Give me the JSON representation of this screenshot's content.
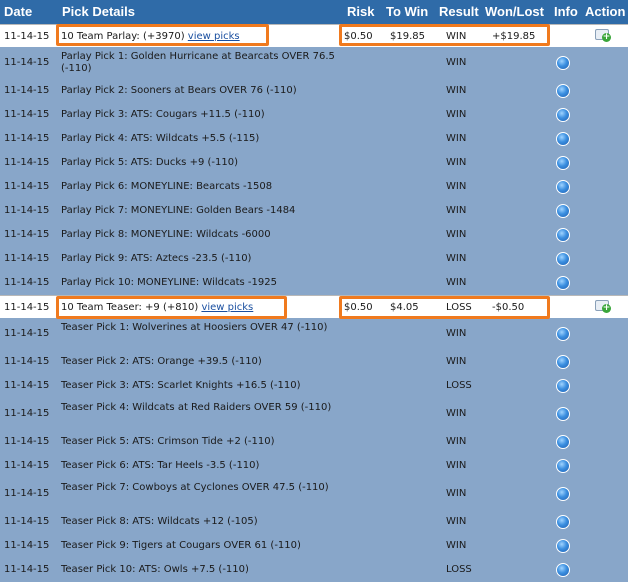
{
  "header": {
    "date": "Date",
    "pick_details": "Pick Details",
    "risk": "Risk",
    "to_win": "To Win",
    "result": "Result",
    "won_lost": "Won/Lost",
    "info": "Info",
    "action": "Action"
  },
  "parlay": {
    "date": "11-14-15",
    "title": "10 Team Parlay: (+3970)",
    "view_picks": "view picks",
    "risk": "$0.50",
    "to_win": "$19.85",
    "result": "WIN",
    "won_lost": "+$19.85",
    "picks": [
      {
        "date": "11-14-15",
        "text": "Parlay Pick 1: Golden Hurricane at Bearcats OVER 76.5 (-110)",
        "result": "WIN"
      },
      {
        "date": "11-14-15",
        "text": "Parlay Pick 2: Sooners at Bears OVER 76 (-110)",
        "result": "WIN"
      },
      {
        "date": "11-14-15",
        "text": "Parlay Pick 3: ATS: Cougars +11.5 (-110)",
        "result": "WIN"
      },
      {
        "date": "11-14-15",
        "text": "Parlay Pick 4: ATS: Wildcats +5.5 (-115)",
        "result": "WIN"
      },
      {
        "date": "11-14-15",
        "text": "Parlay Pick 5: ATS: Ducks +9 (-110)",
        "result": "WIN"
      },
      {
        "date": "11-14-15",
        "text": "Parlay Pick 6: MONEYLINE: Bearcats -1508",
        "result": "WIN"
      },
      {
        "date": "11-14-15",
        "text": "Parlay Pick 7: MONEYLINE: Golden Bears -1484",
        "result": "WIN"
      },
      {
        "date": "11-14-15",
        "text": "Parlay Pick 8: MONEYLINE: Wildcats -6000",
        "result": "WIN"
      },
      {
        "date": "11-14-15",
        "text": "Parlay Pick 9: ATS: Aztecs -23.5 (-110)",
        "result": "WIN"
      },
      {
        "date": "11-14-15",
        "text": "Parlay Pick 10: MONEYLINE: Wildcats -1925",
        "result": "WIN"
      }
    ]
  },
  "teaser": {
    "date": "11-14-15",
    "title": "10 Team Teaser: +9 (+810)",
    "view_picks": "view picks",
    "risk": "$0.50",
    "to_win": "$4.05",
    "result": "LOSS",
    "won_lost": "-$0.50",
    "picks": [
      {
        "date": "11-14-15",
        "text": "Teaser Pick 1: Wolverines at Hoosiers OVER 47 (-110)",
        "result": "WIN"
      },
      {
        "date": "11-14-15",
        "text": "Teaser Pick 2: ATS: Orange +39.5 (-110)",
        "result": "WIN"
      },
      {
        "date": "11-14-15",
        "text": "Teaser Pick 3: ATS: Scarlet Knights +16.5 (-110)",
        "result": "LOSS"
      },
      {
        "date": "11-14-15",
        "text": "Teaser Pick 4: Wildcats at Red Raiders OVER 59 (-110)",
        "result": "WIN"
      },
      {
        "date": "11-14-15",
        "text": "Teaser Pick 5: ATS: Crimson Tide +2 (-110)",
        "result": "WIN"
      },
      {
        "date": "11-14-15",
        "text": "Teaser Pick 6: ATS: Tar Heels -3.5 (-110)",
        "result": "WIN"
      },
      {
        "date": "11-14-15",
        "text": "Teaser Pick 7: Cowboys at Cyclones OVER 47.5 (-110)",
        "result": "WIN"
      },
      {
        "date": "11-14-15",
        "text": "Teaser Pick 8: ATS: Wildcats +12 (-105)",
        "result": "WIN"
      },
      {
        "date": "11-14-15",
        "text": "Teaser Pick 9: Tigers at Cougars OVER 61 (-110)",
        "result": "WIN"
      },
      {
        "date": "11-14-15",
        "text": "Teaser Pick 10: ATS: Owls +7.5 (-110)",
        "result": "LOSS"
      }
    ]
  },
  "colors": {
    "header_bg": "#2f6ba8",
    "child_row_bg": "#88a6c9",
    "highlight": "#f07a1e"
  },
  "icons": {
    "info": "info-circle-icon",
    "action": "add-ticket-icon"
  }
}
